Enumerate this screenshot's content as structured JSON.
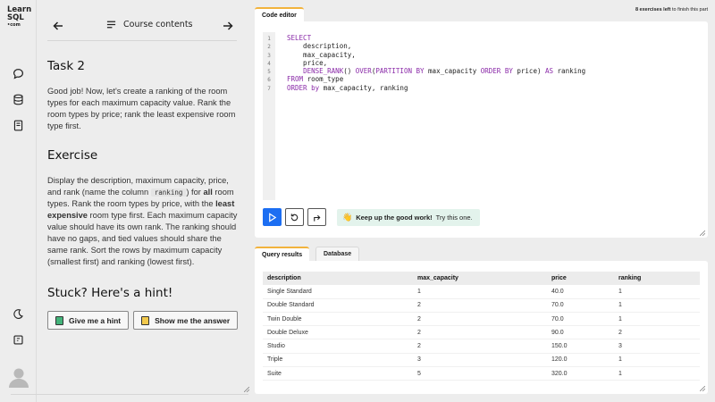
{
  "brand": {
    "line1": "Learn",
    "line2": "SQL",
    "line3": "•com"
  },
  "course": {
    "header_label": "Course contents",
    "task_title": "Task 2",
    "task_text": "Good job! Now, let's create a ranking of the room types for each maximum capacity value. Rank the room types by price; rank the least expensive room type first.",
    "exercise_title": "Exercise",
    "ex_p1_a": "Display the description, maximum capacity, price, and rank (name the column ",
    "ex_p1_code": "ranking",
    "ex_p1_b": ") for ",
    "ex_p1_bold": "all",
    "ex_p1_c": " room types. Rank the room types by price, with the ",
    "ex_p1_bold2": "least expensive",
    "ex_p1_d": " room type first. Each maximum capacity value should have its own rank. The ranking should have no gaps, and tied values should share the same rank. Sort the rows by maximum capacity (smallest first) and ranking (lowest first).",
    "hint_title": "Stuck? Here's a hint!",
    "hint_button": "Give me a hint",
    "answer_button": "Show me the answer"
  },
  "editor": {
    "tab_label": "Code editor",
    "exercises_left_bold": "8 exercises left",
    "exercises_left_rest": " to finish this part",
    "line_numbers": [
      "1",
      "2",
      "3",
      "4",
      "5",
      "6",
      "7"
    ],
    "toast_bold": "Keep up the good work!",
    "toast_rest": " Try this one."
  },
  "results": {
    "tab_query": "Query results",
    "tab_database": "Database",
    "columns": [
      "description",
      "max_capacity",
      "price",
      "ranking"
    ],
    "rows": [
      [
        "Single Standard",
        "1",
        "40.0",
        "1"
      ],
      [
        "Double Standard",
        "2",
        "70.0",
        "1"
      ],
      [
        "Twin Double",
        "2",
        "70.0",
        "1"
      ],
      [
        "Double Deluxe",
        "2",
        "90.0",
        "2"
      ],
      [
        "Studio",
        "2",
        "150.0",
        "3"
      ],
      [
        "Triple",
        "3",
        "120.0",
        "1"
      ],
      [
        "Suite",
        "5",
        "320.0",
        "1"
      ]
    ]
  },
  "colors": {
    "accent": "#1c6ef2",
    "tab_accent": "#f2b33d",
    "keyword": "#8a2aa8",
    "toast_bg": "#e3f3ec"
  },
  "icons": [
    "chat-icon",
    "database-icon",
    "notebook-icon",
    "moon-icon",
    "cheatsheet-icon",
    "avatar-icon",
    "menu-list-icon",
    "arrow-left-icon",
    "arrow-right-icon",
    "run-icon",
    "reset-icon",
    "redo-icon",
    "waving-hand-icon"
  ]
}
